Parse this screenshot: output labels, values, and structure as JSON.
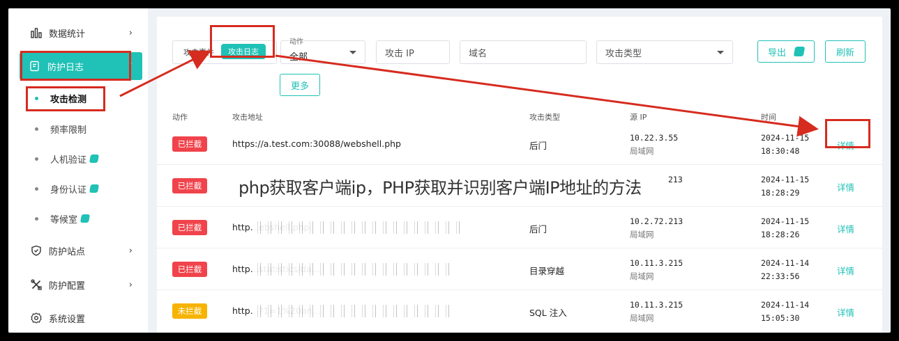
{
  "sidebar": {
    "items": [
      {
        "label": "数据统计",
        "icon": "bar-chart-icon",
        "chevron": "›"
      },
      {
        "label": "防护日志",
        "icon": "log-icon",
        "chevron": "˄"
      },
      {
        "label": "防护站点",
        "icon": "shield-icon",
        "chevron": "›"
      },
      {
        "label": "防护配置",
        "icon": "tools-icon",
        "chevron": "›"
      },
      {
        "label": "系统设置",
        "icon": "gear-icon",
        "chevron": ""
      }
    ],
    "sub_items": [
      {
        "label": "攻击检测",
        "badge": false
      },
      {
        "label": "频率限制",
        "badge": false
      },
      {
        "label": "人机验证",
        "badge": true
      },
      {
        "label": "身份认证",
        "badge": true
      },
      {
        "label": "等候室",
        "badge": true
      }
    ]
  },
  "filters": {
    "tab_events": "攻击事件",
    "tab_logs": "攻击日志",
    "action_label": "动作",
    "action_value": "全部",
    "ip_placeholder": "攻击 IP",
    "domain_placeholder": "域名",
    "type_placeholder": "攻击类型",
    "export_label": "导出",
    "refresh_label": "刷新",
    "more_label": "更多"
  },
  "table": {
    "headers": [
      "动作",
      "攻击地址",
      "攻击类型",
      "源 IP",
      "时间"
    ],
    "rows": [
      {
        "tag": "已拦截",
        "tag_color": "#f0434b",
        "url": "https://a.test.com:30088/webshell.php",
        "type": "后门",
        "ip": "10.22.3.55",
        "net": "局域网",
        "date": "2024-11-15",
        "time": "18:30:48",
        "detail": "详情"
      },
      {
        "tag": "已拦截",
        "tag_color": "#f0434b",
        "url": "",
        "type": "",
        "ip": "213",
        "net": "",
        "date": "2024-11-15",
        "time": "18:28:29",
        "detail": "详情"
      },
      {
        "tag": "已拦截",
        "tag_color": "#f0434b",
        "url": "http…ebshell.php",
        "type": "后门",
        "ip": "10.2.72.213",
        "net": "局域网",
        "date": "2024-11-15",
        "time": "18:28:26",
        "detail": "详情"
      },
      {
        "tag": "已拦截",
        "tag_color": "#f0434b",
        "url": "http…statistics/da…",
        "type": "目录穿越",
        "ip": "10.11.3.215",
        "net": "局域网",
        "date": "2024-11-14",
        "time": "22:33:56",
        "detail": "详情"
      },
      {
        "tag": "未拦截",
        "tag_color": "#f6b300",
        "url": "http…?1=1%20an…",
        "type": "SQL 注入",
        "ip": "10.11.3.215",
        "net": "局域网",
        "date": "2024-11-14",
        "time": "15:05:30",
        "detail": "详情"
      }
    ]
  },
  "watermark": "php获取客户端ip，PHP获取并识别客户端IP地址的方法",
  "colors": {
    "accent": "#20c1b6",
    "annotation": "#d62b1f",
    "blocked": "#f0434b",
    "unblocked": "#f6b300"
  }
}
